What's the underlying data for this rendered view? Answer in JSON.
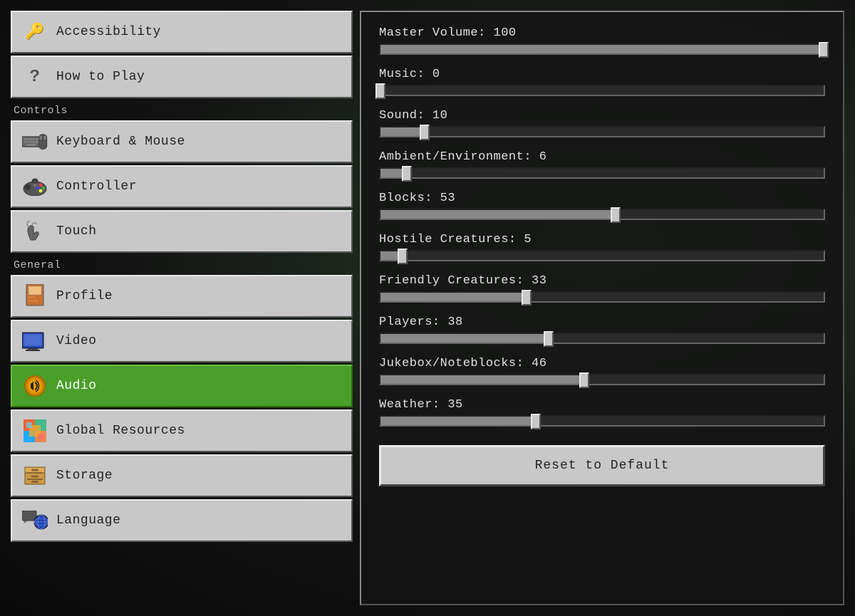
{
  "sidebar": {
    "items": [
      {
        "id": "accessibility",
        "label": "Accessibility",
        "icon": "key",
        "active": false,
        "section": null
      },
      {
        "id": "how-to-play",
        "label": "How to Play",
        "icon": "question",
        "active": false,
        "section": null
      },
      {
        "id": "controls-header",
        "label": "Controls",
        "section": true
      },
      {
        "id": "keyboard-mouse",
        "label": "Keyboard & Mouse",
        "icon": "keyboard",
        "active": false,
        "section": false
      },
      {
        "id": "controller",
        "label": "Controller",
        "icon": "controller",
        "active": false,
        "section": false
      },
      {
        "id": "touch",
        "label": "Touch",
        "icon": "touch",
        "active": false,
        "section": false
      },
      {
        "id": "general-header",
        "label": "General",
        "section": true
      },
      {
        "id": "profile",
        "label": "Profile",
        "icon": "profile",
        "active": false,
        "section": false
      },
      {
        "id": "video",
        "label": "Video",
        "icon": "video",
        "active": false,
        "section": false
      },
      {
        "id": "audio",
        "label": "Audio",
        "icon": "audio",
        "active": true,
        "section": false
      },
      {
        "id": "global-resources",
        "label": "Global Resources",
        "icon": "global-resources",
        "active": false,
        "section": false
      },
      {
        "id": "storage",
        "label": "Storage",
        "icon": "storage",
        "active": false,
        "section": false
      },
      {
        "id": "language",
        "label": "Language",
        "icon": "language",
        "active": false,
        "section": false
      }
    ]
  },
  "main": {
    "sliders": [
      {
        "id": "master-volume",
        "label": "Master Volume",
        "value": 100,
        "percent": 100
      },
      {
        "id": "music",
        "label": "Music",
        "value": 0,
        "percent": 0
      },
      {
        "id": "sound",
        "label": "Sound",
        "value": 10,
        "percent": 10
      },
      {
        "id": "ambient-environment",
        "label": "Ambient/Environment",
        "value": 6,
        "percent": 6
      },
      {
        "id": "blocks",
        "label": "Blocks",
        "value": 53,
        "percent": 53
      },
      {
        "id": "hostile-creatures",
        "label": "Hostile Creatures",
        "value": 5,
        "percent": 5
      },
      {
        "id": "friendly-creatures",
        "label": "Friendly Creatures",
        "value": 33,
        "percent": 33
      },
      {
        "id": "players",
        "label": "Players",
        "value": 38,
        "percent": 38
      },
      {
        "id": "jukebox-noteblocks",
        "label": "Jukebox/Noteblocks",
        "value": 46,
        "percent": 46
      },
      {
        "id": "weather",
        "label": "Weather",
        "value": 35,
        "percent": 35
      }
    ],
    "reset_button_label": "Reset to Default"
  }
}
